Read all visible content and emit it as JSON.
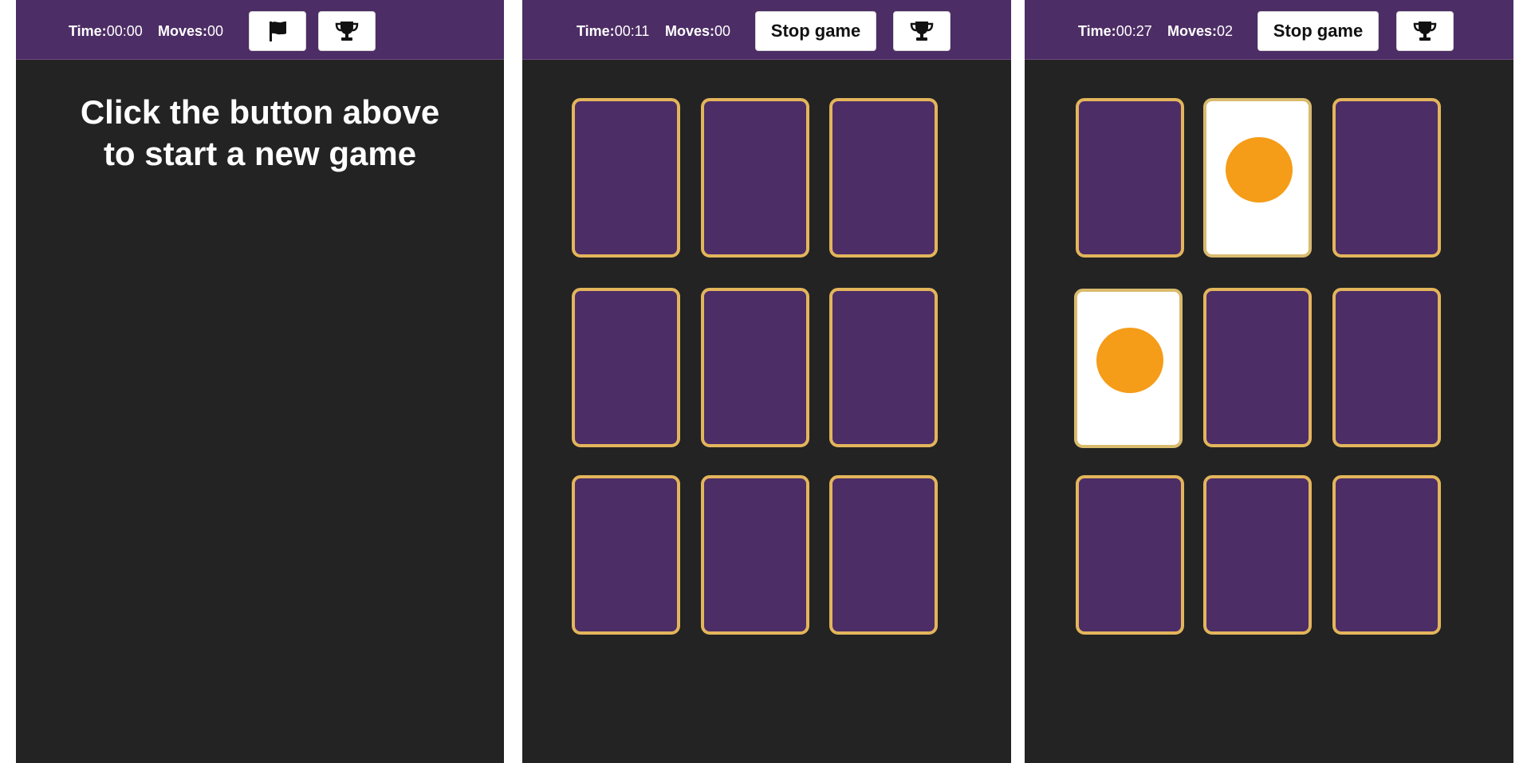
{
  "colors": {
    "page_background": "#ffffff",
    "panel_background": "#232323",
    "header_background": "#4d2d65",
    "card_back": "#4d2d65",
    "card_border": "#e3b55b",
    "card_face": "#ffffff",
    "symbol_color": "#f59c18",
    "text": "#ffffff"
  },
  "panels": [
    {
      "state": "idle",
      "time_label": "Time:",
      "time_value": "00:00",
      "moves_label": "Moves:",
      "moves_value": "00",
      "start_button_icon": "flag-icon",
      "leaderboard_icon": "trophy-icon",
      "message_line1": "Click the button above",
      "message_line2": "to start a new game"
    },
    {
      "state": "playing",
      "time_label": "Time:",
      "time_value": "00:11",
      "moves_label": "Moves:",
      "moves_value": "00",
      "stop_button_label": "Stop game",
      "leaderboard_icon": "trophy-icon",
      "cards": [
        "hidden",
        "hidden",
        "hidden",
        "hidden",
        "hidden",
        "hidden",
        "hidden",
        "hidden",
        "hidden"
      ]
    },
    {
      "state": "playing",
      "time_label": "Time:",
      "time_value": "00:27",
      "moves_label": "Moves:",
      "moves_value": "02",
      "stop_button_label": "Stop game",
      "leaderboard_icon": "trophy-icon",
      "cards": [
        "hidden",
        "revealed:orange-circle",
        "hidden",
        "revealed:orange-circle",
        "hidden",
        "hidden",
        "hidden",
        "hidden",
        "hidden"
      ]
    }
  ]
}
